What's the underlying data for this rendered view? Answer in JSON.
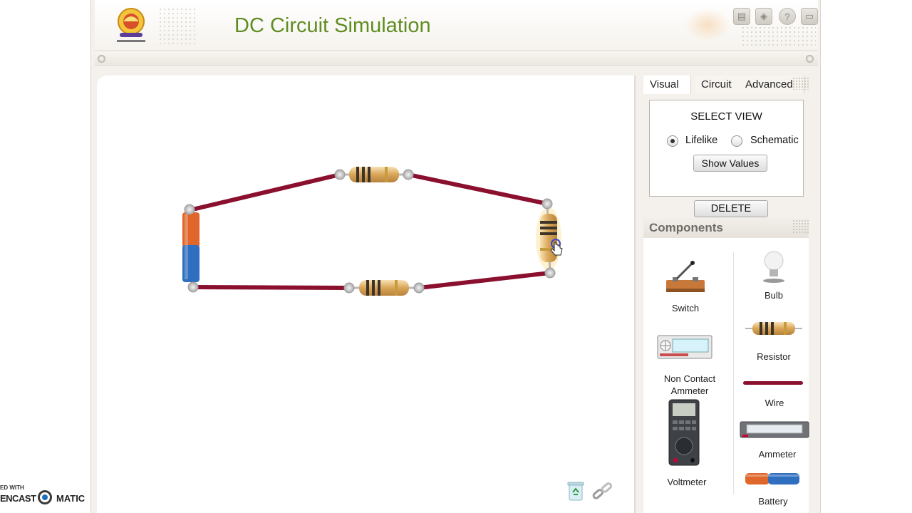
{
  "header": {
    "title": "DC Circuit Simulation",
    "toolbar": [
      {
        "icon": "save-icon",
        "glyph": "▤"
      },
      {
        "icon": "layers-icon",
        "glyph": "◈"
      },
      {
        "icon": "help-icon",
        "glyph": "?"
      },
      {
        "icon": "fullscreen-icon",
        "glyph": "▭"
      }
    ]
  },
  "tabs": [
    {
      "label": "Visual"
    },
    {
      "label": "Circuit"
    },
    {
      "label": "Advanced"
    }
  ],
  "view_panel": {
    "title": "SELECT VIEW",
    "options": [
      {
        "label": "Lifelike",
        "selected": true
      },
      {
        "label": "Schematic",
        "selected": false
      }
    ],
    "show_values_label": "Show Values",
    "delete_label": "DELETE"
  },
  "components": {
    "title": "Components",
    "items": [
      {
        "label": "Switch"
      },
      {
        "label": "Bulb"
      },
      {
        "label": "Non Contact Ammeter"
      },
      {
        "label": "Resistor"
      },
      {
        "label": "Wire"
      },
      {
        "label": "Voltmeter"
      },
      {
        "label": "Ammeter"
      },
      {
        "label": "Battery"
      }
    ]
  },
  "watermark": {
    "line1": "ED WITH",
    "line2a": "ENCAST",
    "line2b": "MATIC"
  },
  "colors": {
    "title_green": "#5f8d22",
    "wire": "#8b0f2e",
    "battery_orange": "#e0672b",
    "battery_blue": "#2e6fc0"
  }
}
